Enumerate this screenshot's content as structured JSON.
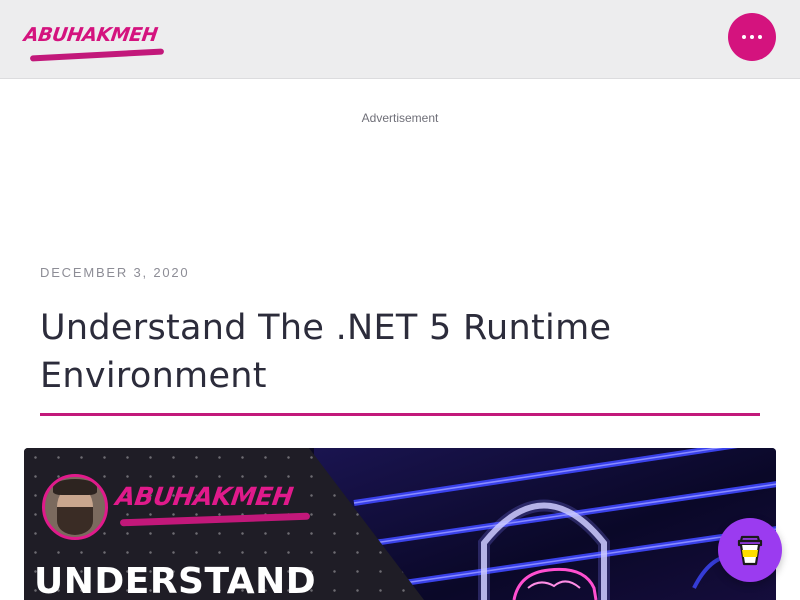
{
  "header": {
    "logo_text": "ABUHAKMEH",
    "menu_icon": "ellipsis-icon",
    "accent_color": "#d4137e"
  },
  "ad": {
    "label": "Advertisement"
  },
  "article": {
    "date": "DECEMBER 3, 2020",
    "title": "Understand The .NET 5 Runtime Environment",
    "rule_color": "#c2187a"
  },
  "hero": {
    "logo_text": "ABUHAKMEH",
    "heading": "UNDERSTAND"
  },
  "floating": {
    "icon": "coffee-cup-icon",
    "color": "#9b3bf0"
  }
}
